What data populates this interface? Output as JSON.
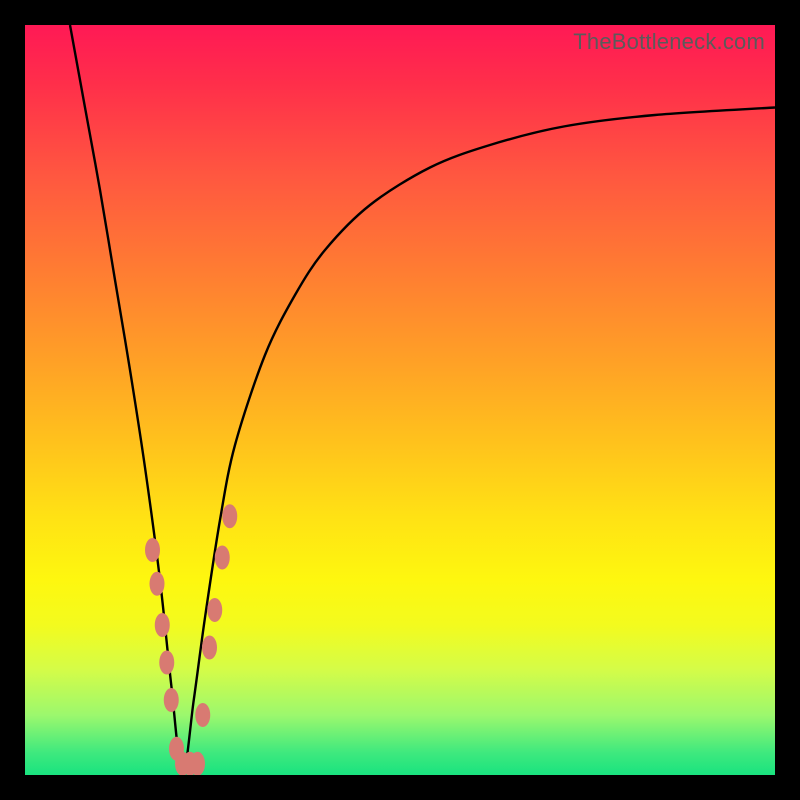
{
  "watermark": "TheBottleneck.com",
  "colors": {
    "frame": "#000000",
    "curve": "#000000",
    "marker": "#d87a72",
    "gradient_top": "#ff1955",
    "gradient_bottom": "#19e37f"
  },
  "chart_data": {
    "type": "line",
    "title": "",
    "xlabel": "",
    "ylabel": "",
    "xlim": [
      0,
      100
    ],
    "ylim": [
      0,
      100
    ],
    "grid": false,
    "note": "Axes are unlabeled; values estimated from pixel positions on a 0–100 normalized scale where y=0 is the bottom (green) and y=100 is the top (red). The curve is a V-shaped bottleneck curve reaching ~0 near x≈21.",
    "series": [
      {
        "name": "bottleneck-curve",
        "x": [
          6,
          8,
          10,
          12,
          14,
          16,
          18,
          19.5,
          21,
          22.5,
          24,
          26,
          28,
          32,
          36,
          40,
          46,
          54,
          62,
          72,
          84,
          100
        ],
        "y": [
          100,
          89,
          78,
          66,
          54,
          41,
          26,
          12,
          0,
          10,
          21,
          34,
          44,
          56,
          64,
          70,
          76,
          81,
          84,
          86.5,
          88,
          89
        ]
      }
    ],
    "markers": {
      "name": "highlighted-points",
      "note": "Oblong salmon markers clustered around the trough of the V.",
      "points": [
        {
          "x": 17.0,
          "y": 30.0
        },
        {
          "x": 17.6,
          "y": 25.5
        },
        {
          "x": 18.3,
          "y": 20.0
        },
        {
          "x": 18.9,
          "y": 15.0
        },
        {
          "x": 19.5,
          "y": 10.0
        },
        {
          "x": 20.2,
          "y": 3.5
        },
        {
          "x": 21.0,
          "y": 1.5
        },
        {
          "x": 22.0,
          "y": 1.5
        },
        {
          "x": 23.0,
          "y": 1.5
        },
        {
          "x": 23.7,
          "y": 8.0
        },
        {
          "x": 24.6,
          "y": 17.0
        },
        {
          "x": 25.3,
          "y": 22.0
        },
        {
          "x": 26.3,
          "y": 29.0
        },
        {
          "x": 27.3,
          "y": 34.5
        }
      ]
    }
  }
}
